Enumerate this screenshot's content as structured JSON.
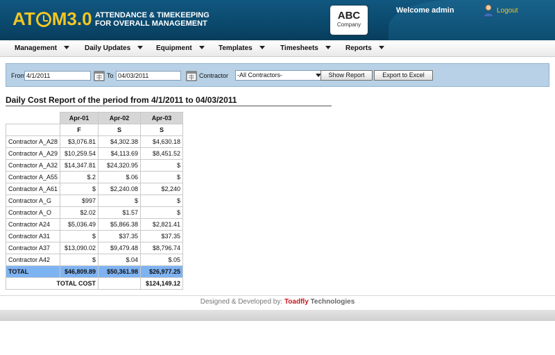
{
  "header": {
    "logo_prefix": "AT",
    "logo_suffix": "M3.0",
    "tagline_line1": "ATTENDANCE & TIMEKEEPING",
    "tagline_line2": "FOR OVERALL MANAGEMENT",
    "company_name": "ABC",
    "company_sub": "Company",
    "welcome": "Welcome admin",
    "logout_label": "Logout",
    "accent_color": "#f3c623",
    "bg_color": "#0b4a6e"
  },
  "nav": {
    "items": [
      {
        "label": "Management"
      },
      {
        "label": "Daily Updates"
      },
      {
        "label": "Equipment"
      },
      {
        "label": "Templates"
      },
      {
        "label": "Timesheets"
      },
      {
        "label": "Reports"
      }
    ]
  },
  "filter": {
    "from_label": "From",
    "from_value": "4/1/2011",
    "to_label": "To",
    "to_value": "04/03/2011",
    "contractor_label": "Contractor",
    "contractor_value": "-All Contractors-",
    "show_report_label": "Show Report",
    "export_label": "Export to Excel",
    "bar_color": "#b8d1e6"
  },
  "report": {
    "title": "Daily Cost Report of the period from 4/1/2011 to 04/03/2011",
    "columns": [
      {
        "date": "Apr-01",
        "day": "F"
      },
      {
        "date": "Apr-02",
        "day": "S"
      },
      {
        "date": "Apr-03",
        "day": "S"
      }
    ],
    "rows": [
      {
        "name": "Contractor A_A28",
        "values": [
          "$3,076.81",
          "$4,302.38",
          "$4,630.18"
        ]
      },
      {
        "name": "Contractor A_A29",
        "values": [
          "$10,259.54",
          "$4,113.69",
          "$8,451.52"
        ]
      },
      {
        "name": "Contractor A_A32",
        "values": [
          "$14,347.81",
          "$24,320.95",
          "$"
        ]
      },
      {
        "name": "Contractor A_A55",
        "values": [
          "$.2",
          "$.06",
          "$"
        ]
      },
      {
        "name": "Contractor A_A61",
        "values": [
          "$",
          "$2,240.08",
          "$2,240"
        ]
      },
      {
        "name": "Contractor A_G",
        "values": [
          "$997",
          "$",
          "$"
        ]
      },
      {
        "name": "Contractor A_O",
        "values": [
          "$2.02",
          "$1.57",
          "$"
        ]
      },
      {
        "name": "Contractor A24",
        "values": [
          "$5,036.49",
          "$5,866.38",
          "$2,821.41"
        ]
      },
      {
        "name": "Contractor A31",
        "values": [
          "$",
          "$37.35",
          "$37.35"
        ]
      },
      {
        "name": "Contractor A37",
        "values": [
          "$13,090.02",
          "$9,479.48",
          "$8,796.74"
        ]
      },
      {
        "name": "Contractor A42",
        "values": [
          "$",
          "$.04",
          "$.05"
        ]
      }
    ],
    "total_label": "TOTAL",
    "totals": [
      "$46,809.89",
      "$50,361.98",
      "$26,977.25"
    ],
    "total_cost_label": "TOTAL COST",
    "total_cost_value": "$124,149.12",
    "total_row_color": "#7eb3f2"
  },
  "footer": {
    "prefix": "Designed & Developed by:",
    "brand1": "Toadfly",
    "brand2": "Technologies",
    "brand1_color": "#c8161d"
  }
}
